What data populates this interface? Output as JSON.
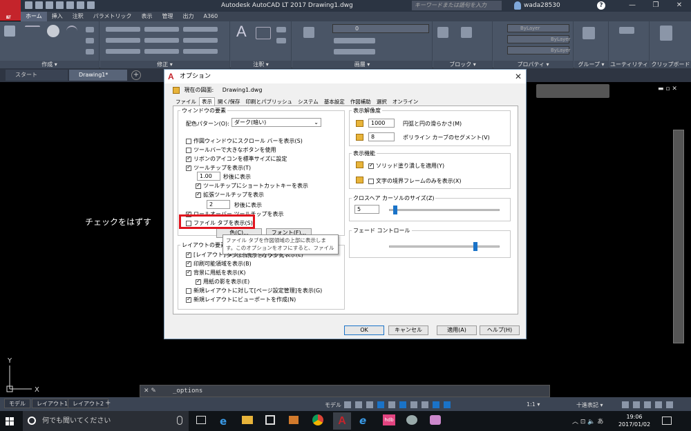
{
  "titlebar": {
    "logo": "A",
    "logo_sub": "LT",
    "title": "Autodesk AutoCAD LT 2017    Drawing1.dwg",
    "search_placeholder": "キーワードまたは語句を入力",
    "user": "wada28530"
  },
  "ribbon": {
    "tabs": [
      "ホーム",
      "挿入",
      "注釈",
      "パラメトリック",
      "表示",
      "管理",
      "出力",
      "A360"
    ],
    "panels": [
      "作成 ▾",
      "修正 ▾",
      "注釈 ▾",
      "画層 ▾",
      "ブロック ▾",
      "プロパティ ▾",
      "グループ ▾",
      "ユーティリティ ▾",
      "クリップボード"
    ],
    "bylayer": "ByLayer",
    "layer_value": "0"
  },
  "doc_tabs": {
    "start": "スタート",
    "drawing": "Drawing1*"
  },
  "annotation": "チェックをはずす",
  "command_line": {
    "text": "_options"
  },
  "status": {
    "layout_tabs": [
      "モデル",
      "レイアウト1",
      "レイアウト2"
    ],
    "model": "モデル",
    "ratio": "1:1 ▾",
    "standard": "十進表記 ▾"
  },
  "taskbar": {
    "search": "何でも聞いてください",
    "time": "19:06",
    "date": "2017/01/02"
  },
  "dialog": {
    "title": "オプション",
    "profile_label": "現在の図面:",
    "profile_value": "Drawing1.dwg",
    "tabs": [
      "ファイル",
      "表示",
      "開く/保存",
      "印刷とパブリッシュ",
      "システム",
      "基本設定",
      "作図補助",
      "選択",
      "オンライン"
    ],
    "window_group": "ウィンドウの要素",
    "color_scheme_label": "配色パターン(O):",
    "color_scheme_value": "ダーク(暗い)",
    "window_items": [
      {
        "label": "作図ウィンドウにスクロール バーを表示(S)",
        "checked": false
      },
      {
        "label": "ツールバーで大きなボタンを使用",
        "checked": false
      },
      {
        "label": "リボンのアイコンを標準サイズに設定",
        "checked": true
      },
      {
        "label": "ツールチップを表示(T)",
        "checked": true
      }
    ],
    "tooltip_delay": "1.00",
    "tooltip_delay_label": "秒後に表示",
    "shortcut_tip": "ツールチップにショートカットキーを表示",
    "ext_tip": "拡張ツールチップを表示",
    "ext_delay": "2",
    "ext_delay_label": "秒後に表示",
    "rollover_tip": "ロールオーバー ツールチップを表示",
    "file_tabs": "ファイル タブを表示(S)",
    "color_btn": "色(C)...",
    "font_btn": "フォント(F)...",
    "layout_group": "レイアウトの要素",
    "layout_items": [
      {
        "label": "[レイアウト] タブと [モデル] タブを表示(L)",
        "checked": true
      },
      {
        "label": "印刷可能領域を表示(B)",
        "checked": true
      },
      {
        "label": "背景に用紙を表示(K)",
        "checked": true
      },
      {
        "label": "用紙の影を表示(E)",
        "checked": true,
        "indent": true
      },
      {
        "label": "新規レイアウトに対して[ページ設定管理]を表示(G)",
        "checked": false
      },
      {
        "label": "新規レイアウトにビューポートを作成(N)",
        "checked": true
      }
    ],
    "resolution_group": "表示解像度",
    "arc_value": "1000",
    "arc_label": "円弧と円の滑らかさ(M)",
    "poly_value": "8",
    "poly_label": "ポリライン カーブのセグメント(V)",
    "perf_group": "表示機能",
    "solid_fill": "ソリッド塗り潰しを適用(Y)",
    "text_frame": "文字の境界フレームのみを表示(X)",
    "crosshair_group": "クロスヘア カーソルのサイズ(Z)",
    "crosshair_value": "5",
    "crosshair_level": 5,
    "fade_group": "フェード コントロール",
    "fade_level": 0.79,
    "tooltip_text": "ファイル タブを作図領域の上部に表示します。このオプションをオフにすると、ファイル タブは非表示となります。",
    "ok": "OK",
    "cancel": "キャンセル",
    "apply": "適用(A)",
    "help": "ヘルプ(H)"
  },
  "colors": {
    "accent": "#1a73c8",
    "highlight": "#e0141e",
    "logo": "#c4242b"
  }
}
